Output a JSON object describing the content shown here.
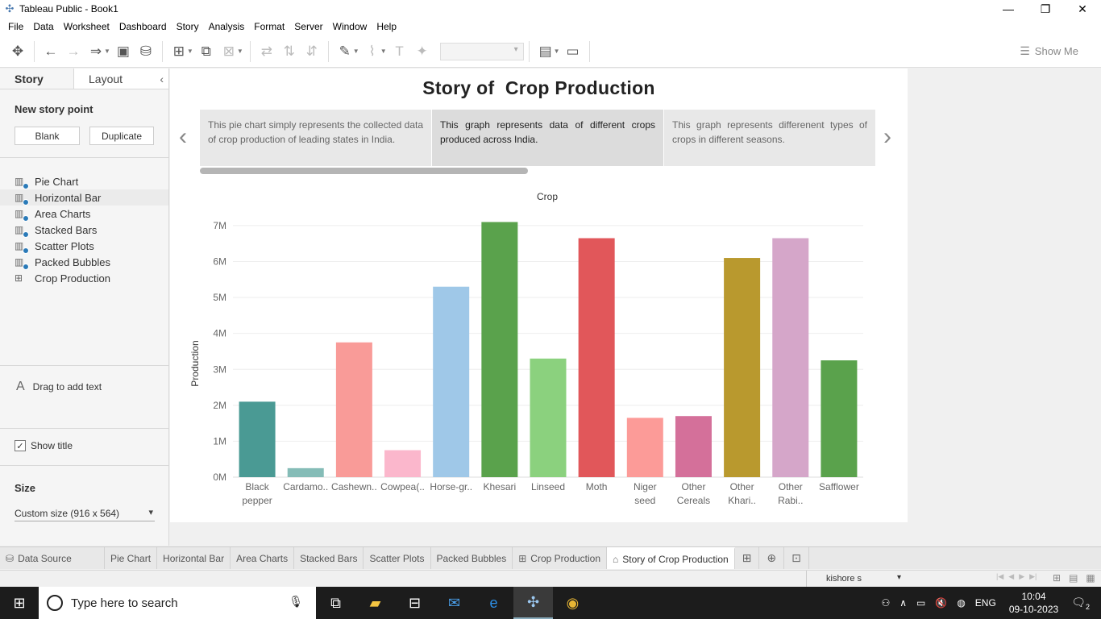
{
  "window": {
    "title": "Tableau Public - Book1",
    "minimize": "—",
    "restore": "❐",
    "close": "✕"
  },
  "menu": [
    "File",
    "Data",
    "Worksheet",
    "Dashboard",
    "Story",
    "Analysis",
    "Format",
    "Server",
    "Window",
    "Help"
  ],
  "toolbar": {
    "show_me": "Show Me"
  },
  "sidebar": {
    "tabs": {
      "story": "Story",
      "layout": "Layout"
    },
    "new_story_point": "New story point",
    "blank_button": "Blank",
    "duplicate_button": "Duplicate",
    "sheets": [
      {
        "label": "Pie Chart",
        "icon": "worksheet-icon"
      },
      {
        "label": "Horizontal Bar",
        "icon": "worksheet-icon"
      },
      {
        "label": "Area Charts",
        "icon": "worksheet-icon"
      },
      {
        "label": "Stacked Bars",
        "icon": "worksheet-icon"
      },
      {
        "label": "Scatter Plots",
        "icon": "worksheet-icon"
      },
      {
        "label": "Packed Bubbles",
        "icon": "worksheet-icon"
      },
      {
        "label": "Crop Production",
        "icon": "dashboard-icon"
      }
    ],
    "drag_text": "Drag to add text",
    "show_title": "Show title",
    "size_label": "Size",
    "size_value": "Custom size (916 x 564)"
  },
  "story": {
    "title": "Story of  Crop Production",
    "captions": [
      "This pie chart simply represents the collected data of crop production of leading states in India.",
      "This graph represents data of different crops produced across India.",
      "This  graph  represents  differenent types  of crops in  different  seasons."
    ],
    "prev_arrow": "‹",
    "next_arrow": "›"
  },
  "chart_data": {
    "type": "bar",
    "title": "Crop",
    "xlabel": "",
    "ylabel": "Production",
    "categories": [
      "Black pepper",
      "Cardamo..",
      "Cashewn..",
      "Cowpea(..",
      "Horse-gr..",
      "Khesari",
      "Linseed",
      "Moth",
      "Niger seed",
      "Other Cereals",
      "Other Khari..",
      "Other Rabi..",
      "Safflower"
    ],
    "category_lines": [
      [
        "Black",
        "pepper"
      ],
      [
        "Cardamo.."
      ],
      [
        "Cashewn.."
      ],
      [
        "Cowpea(.."
      ],
      [
        "Horse-gr.."
      ],
      [
        "Khesari"
      ],
      [
        "Linseed"
      ],
      [
        "Moth"
      ],
      [
        "Niger",
        "seed"
      ],
      [
        "Other",
        "Cereals"
      ],
      [
        "Other",
        "Khari.."
      ],
      [
        "Other",
        "Rabi.."
      ],
      [
        "Safflower"
      ]
    ],
    "values": [
      2100000,
      250000,
      3750000,
      750000,
      5300000,
      7100000,
      3300000,
      6650000,
      1650000,
      1700000,
      6100000,
      6650000,
      3250000
    ],
    "colors": [
      "#4a9a94",
      "#85bcb7",
      "#f99b98",
      "#fbb7cc",
      "#9fc8e8",
      "#5aa24c",
      "#8bd17e",
      "#e1575a",
      "#fc9b98",
      "#d4709a",
      "#b9992e",
      "#d5a6c9",
      "#5aa24c"
    ],
    "yticks": [
      "0M",
      "1M",
      "2M",
      "3M",
      "4M",
      "5M",
      "6M",
      "7M"
    ],
    "ylim": [
      0,
      7200000
    ],
    "grid": true
  },
  "bottom_tabs": [
    {
      "label": "Data Source",
      "icon": "database-icon"
    },
    {
      "label": "Pie Chart"
    },
    {
      "label": "Horizontal Bar"
    },
    {
      "label": "Area Charts"
    },
    {
      "label": "Stacked Bars"
    },
    {
      "label": "Scatter Plots"
    },
    {
      "label": "Packed Bubbles"
    },
    {
      "label": "Crop Production",
      "icon": "dashboard-icon"
    },
    {
      "label": "Story of Crop Production",
      "icon": "story-icon",
      "active": true
    }
  ],
  "status": {
    "user": "kishore s"
  },
  "taskbar": {
    "search_placeholder": "Type here to search",
    "language": "ENG",
    "time": "10:04",
    "date": "09-10-2023",
    "notifications": "2"
  }
}
